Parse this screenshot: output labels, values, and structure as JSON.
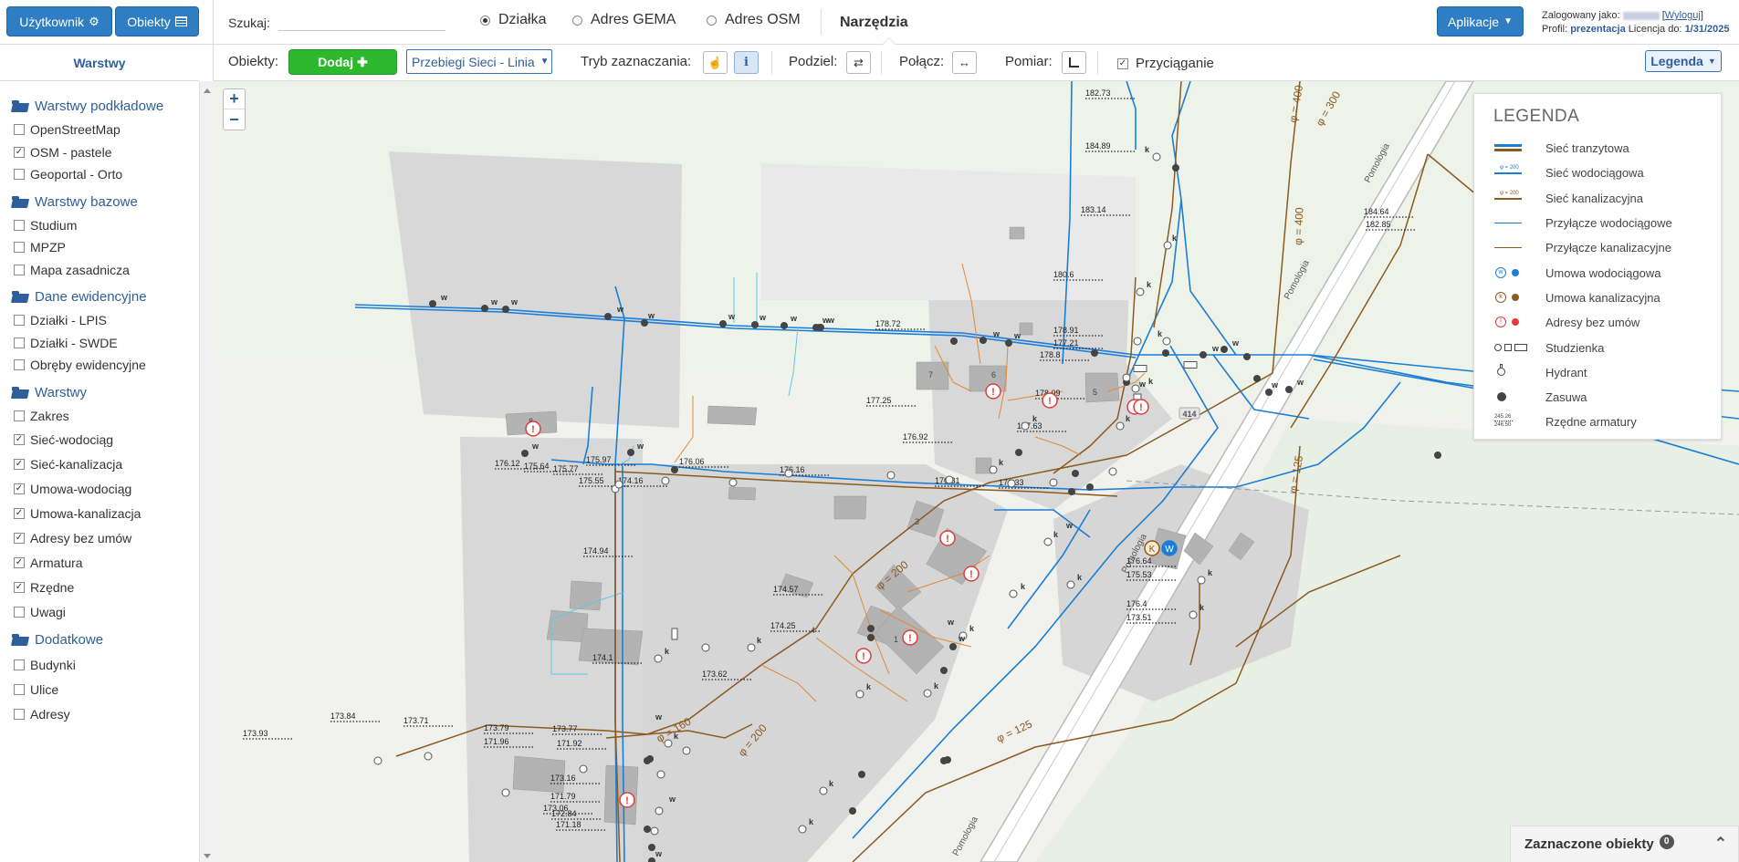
{
  "topbar": {
    "user_button": "Użytkownik",
    "objects_button": "Obiekty",
    "search_label": "Szukaj:",
    "search_value": "",
    "search_modes": [
      {
        "label": "Działka",
        "checked": true
      },
      {
        "label": "Adres GEMA",
        "checked": false
      },
      {
        "label": "Adres OSM",
        "checked": false
      }
    ],
    "tools_title": "Narzędzia",
    "apps_button": "Aplikacje",
    "logged_in_label": "Zalogowany jako:",
    "logout_link": "Wyloguj",
    "profile_label": "Profil:",
    "profile_value": "prezentacja",
    "license_label": "Licencja do:",
    "license_value": "1/31/2025"
  },
  "toolbar": {
    "objects_label": "Obiekty:",
    "add_button": "Dodaj",
    "layer_select": "Przebiegi Sieci - Linia",
    "selection_mode_label": "Tryb zaznaczania:",
    "split_label": "Podziel:",
    "join_label": "Połącz:",
    "measure_label": "Pomiar:",
    "snapping_label": "Przyciąganie",
    "snapping_checked": true,
    "legend_button": "Legenda"
  },
  "sidebar": {
    "title": "Warstwy",
    "groups": [
      {
        "name": "Warstwy podkładowe",
        "items": [
          {
            "label": "OpenStreetMap",
            "checked": false
          },
          {
            "label": "OSM - pastele",
            "checked": true
          },
          {
            "label": "Geoportal - Orto",
            "checked": false
          }
        ]
      },
      {
        "name": "Warstwy bazowe",
        "items": [
          {
            "label": "Studium",
            "checked": false
          },
          {
            "label": "MPZP",
            "checked": false
          },
          {
            "label": "Mapa zasadnicza",
            "checked": false
          }
        ]
      },
      {
        "name": "Dane ewidencyjne",
        "items": [
          {
            "label": "Działki - LPIS",
            "checked": false
          },
          {
            "label": "Działki - SWDE",
            "checked": false
          },
          {
            "label": "Obręby ewidencyjne",
            "checked": false
          }
        ]
      },
      {
        "name": "Warstwy",
        "items": [
          {
            "label": "Zakres",
            "checked": false
          },
          {
            "label": "Sieć-wodociąg",
            "checked": true
          },
          {
            "label": "Sieć-kanalizacja",
            "checked": true
          },
          {
            "label": "Umowa-wodociąg",
            "checked": true
          },
          {
            "label": "Umowa-kanalizacja",
            "checked": true
          },
          {
            "label": "Adresy bez umów",
            "checked": true
          },
          {
            "label": "Armatura",
            "checked": true
          },
          {
            "label": "Rzędne",
            "checked": true
          },
          {
            "label": "Uwagi",
            "checked": false
          }
        ]
      },
      {
        "name": "Dodatkowe",
        "items": [
          {
            "label": "Budynki",
            "checked": false
          },
          {
            "label": "Ulice",
            "checked": false
          },
          {
            "label": "Adresy",
            "checked": false
          }
        ]
      }
    ]
  },
  "map": {
    "zoom_in": "+",
    "zoom_out": "−",
    "street_names": [
      "Pomologia",
      "Pomologia",
      "Pomologia",
      "Pomologia"
    ],
    "road_number": "414",
    "pipe_labels": [
      "φ = 400",
      "φ = 300",
      "φ = 400",
      "φ = 125",
      "φ = 200",
      "φ = 200",
      "φ = 160",
      "φ = 125"
    ],
    "elevations": [
      "182.73",
      "184.89",
      "183.14",
      "180.6",
      "178.91",
      "177.21",
      "178.72",
      "178.8",
      "178.09",
      "177.25",
      "177.63",
      "176.92",
      "176.33",
      "176.81",
      "176.16",
      "176.06",
      "175.77",
      "175.64",
      "175.97",
      "175.55",
      "174.16",
      "176.12",
      "174.94",
      "174.57",
      "174.25",
      "174.1",
      "173.62",
      "173.84",
      "173.71",
      "173.93",
      "173.79",
      "171.96",
      "173.77",
      "171.92",
      "173.16",
      "171.79",
      "173.06",
      "172.84",
      "171.18",
      "176.64",
      "175.53",
      "176.4",
      "173.51",
      "184.64",
      "182.85"
    ],
    "building_numbers": [
      "8",
      "7",
      "6",
      "5",
      "3",
      "2",
      "4",
      "1"
    ]
  },
  "legend": {
    "title": "LEGENDA",
    "items": [
      {
        "label": "Sieć tranzytowa",
        "icon": "transit-network-icon"
      },
      {
        "label": "Sieć wodociągowa",
        "icon": "water-network-icon"
      },
      {
        "label": "Sieć kanalizacyjna",
        "icon": "sewer-network-icon"
      },
      {
        "label": "Przyłącze wodociągowe",
        "icon": "water-connection-icon"
      },
      {
        "label": "Przyłącze kanalizacyjne",
        "icon": "sewer-connection-icon"
      },
      {
        "label": "Umowa wodociągowa",
        "icon": "water-contract-icon"
      },
      {
        "label": "Umowa kanalizacyjna",
        "icon": "sewer-contract-icon"
      },
      {
        "label": "Adresy bez umów",
        "icon": "address-without-contract-icon"
      },
      {
        "label": "Studzienka",
        "icon": "manhole-icon"
      },
      {
        "label": "Hydrant",
        "icon": "hydrant-icon"
      },
      {
        "label": "Zasuwa",
        "icon": "valve-icon"
      },
      {
        "label": "Rzędne armatury",
        "icon": "fitting-elevation-icon"
      }
    ],
    "legend_sample_small": "φ = 200",
    "elevation_sample_top": "245.26",
    "elevation_sample_bottom": "246.50"
  },
  "selected_panel": {
    "label": "Zaznaczone obiekty",
    "count": "0"
  },
  "colors": {
    "accent": "#2f7ec3",
    "water": "#1a7ed6",
    "sewer": "#8b5a1e",
    "water_connection": "#5fc8e8",
    "sewer_connection": "#e08a32",
    "warning": "#e23b3b",
    "add_green": "#2eb82e"
  }
}
